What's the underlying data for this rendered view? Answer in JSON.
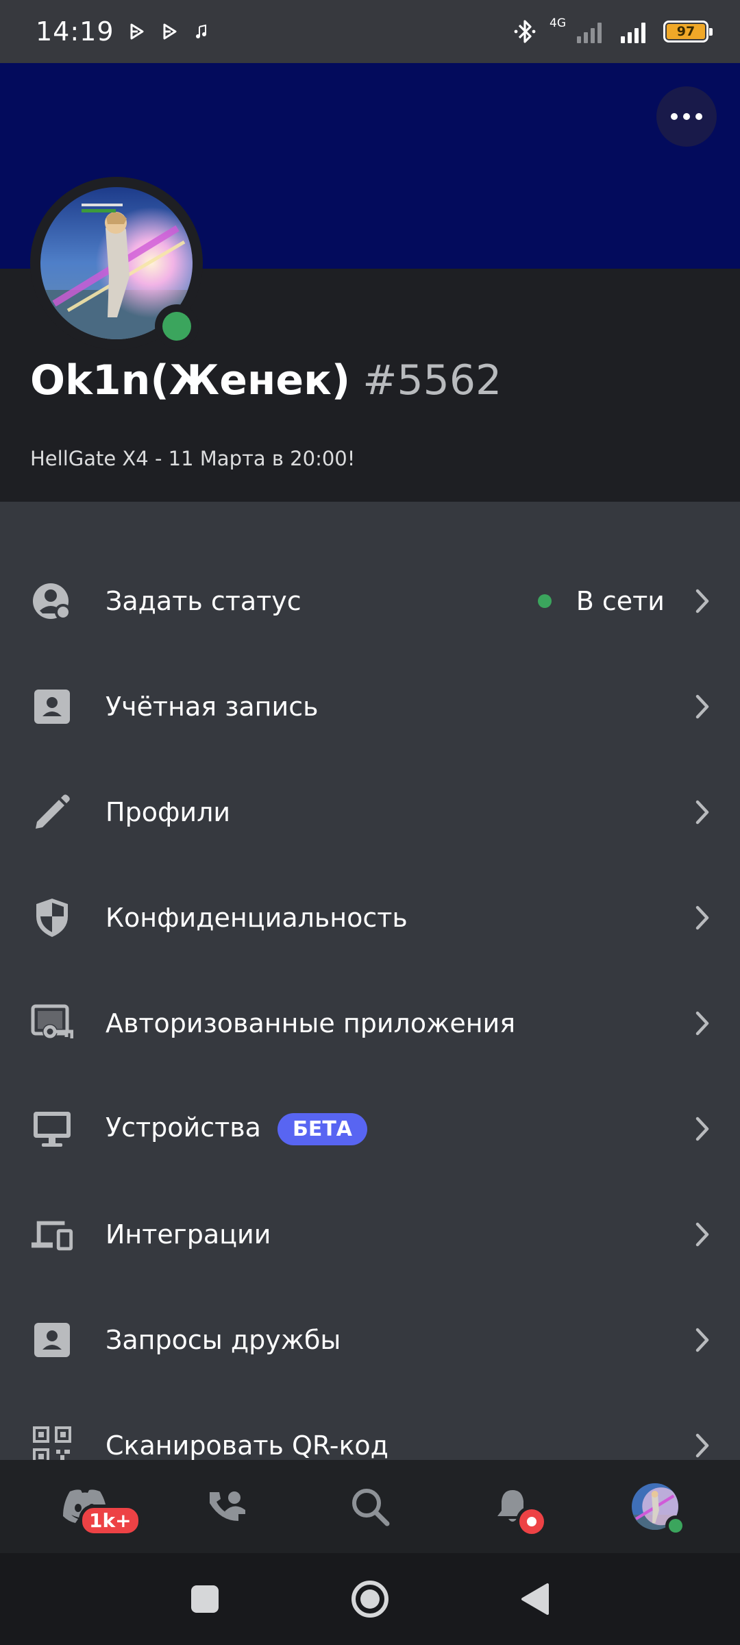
{
  "status_bar": {
    "time": "14:19",
    "network": "4G",
    "battery": "97",
    "icons": [
      "play-icon",
      "play-icon",
      "music-note-icon",
      "bluetooth-icon",
      "signal-icon",
      "signal-icon",
      "battery-icon"
    ]
  },
  "profile": {
    "username": "Ok1n(Женек)",
    "discriminator": "#5562",
    "about": "HellGate X4 - 11 Марта в 20:00!",
    "banner_color": "#030b5c",
    "online_status": "online"
  },
  "settings": {
    "items": [
      {
        "label": "Задать статус",
        "icon": "user-status-icon",
        "value": "В сети"
      },
      {
        "label": "Учётная запись",
        "icon": "id-card-icon"
      },
      {
        "label": "Профили",
        "icon": "pencil-icon"
      },
      {
        "label": "Конфиденциальность",
        "icon": "shield-icon"
      },
      {
        "label": "Авторизованные приложения",
        "icon": "authorized-apps-icon"
      },
      {
        "label": "Устройства",
        "icon": "monitor-icon",
        "badge": "БЕТА"
      },
      {
        "label": "Интеграции",
        "icon": "devices-icon"
      },
      {
        "label": "Запросы дружбы",
        "icon": "id-card-icon"
      },
      {
        "label": "Сканировать QR-код",
        "icon": "qr-code-icon"
      }
    ]
  },
  "bottom_nav": {
    "tabs": [
      {
        "name": "home",
        "icon": "discord-icon",
        "badge": "1k+"
      },
      {
        "name": "friends",
        "icon": "friends-icon"
      },
      {
        "name": "search",
        "icon": "search-icon"
      },
      {
        "name": "notifications",
        "icon": "bell-icon"
      },
      {
        "name": "profile",
        "icon": "avatar"
      }
    ]
  },
  "colors": {
    "accent": "#5865f2",
    "online": "#3ba55d",
    "danger": "#ed4245",
    "background": "#36393f",
    "header": "#1e1f23"
  }
}
